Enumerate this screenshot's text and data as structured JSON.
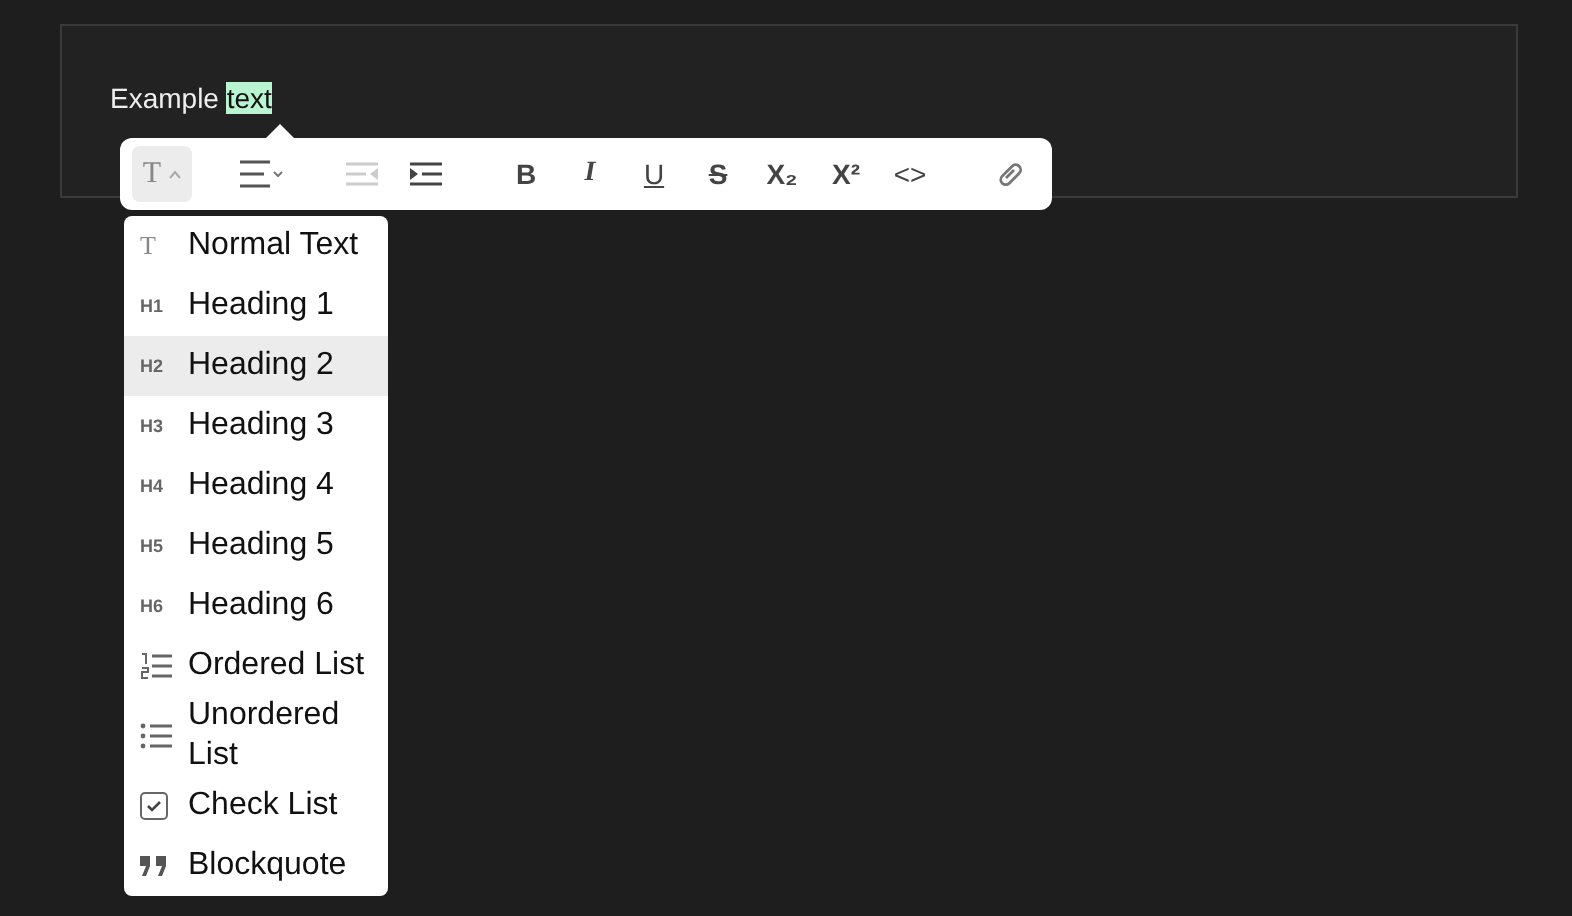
{
  "editor": {
    "text": "Example",
    "selected_text": "text"
  },
  "toolbar": [
    {
      "kind": "block-type",
      "label": "T",
      "expanded": true
    },
    {
      "kind": "separator"
    },
    {
      "kind": "align"
    },
    {
      "kind": "separator"
    },
    {
      "kind": "outdent",
      "disabled": true
    },
    {
      "kind": "indent",
      "disabled": false
    },
    {
      "kind": "separator"
    },
    {
      "kind": "bold",
      "label": "B"
    },
    {
      "kind": "italic",
      "label": "I"
    },
    {
      "kind": "underline",
      "label": "U"
    },
    {
      "kind": "strike",
      "label": "S"
    },
    {
      "kind": "subscript",
      "label": "X₂"
    },
    {
      "kind": "superscript",
      "label": "X²"
    },
    {
      "kind": "code",
      "label": "<>"
    },
    {
      "kind": "separator"
    },
    {
      "kind": "link"
    }
  ],
  "menu": [
    {
      "kind": "text",
      "icon_label": "T",
      "label": "Normal Text",
      "selected": false
    },
    {
      "kind": "text",
      "icon_label": "H1",
      "label": "Heading 1",
      "selected": false
    },
    {
      "kind": "text",
      "icon_label": "H2",
      "label": "Heading 2",
      "selected": true
    },
    {
      "kind": "text",
      "icon_label": "H3",
      "label": "Heading 3",
      "selected": false
    },
    {
      "kind": "text",
      "icon_label": "H4",
      "label": "Heading 4",
      "selected": false
    },
    {
      "kind": "text",
      "icon_label": "H5",
      "label": "Heading 5",
      "selected": false
    },
    {
      "kind": "text",
      "icon_label": "H6",
      "label": "Heading 6",
      "selected": false
    },
    {
      "kind": "ordered",
      "label": "Ordered List",
      "selected": false
    },
    {
      "kind": "unordered",
      "label": "Unordered List",
      "selected": false
    },
    {
      "kind": "check",
      "label": "Check List",
      "selected": false
    },
    {
      "kind": "quote",
      "label": "Blockquote",
      "selected": false
    }
  ]
}
